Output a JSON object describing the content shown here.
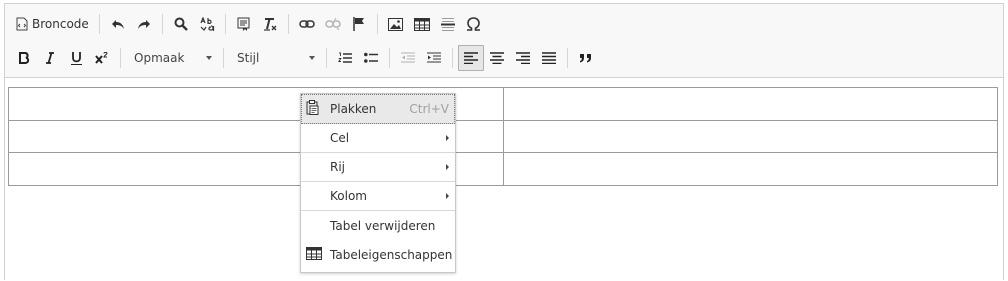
{
  "toolbar": {
    "source_label": "Broncode",
    "format_label": "Opmaak",
    "style_label": "Stijl"
  },
  "context_menu": {
    "items": [
      {
        "label": "Plakken",
        "shortcut": "Ctrl+V",
        "icon": "paste-icon"
      },
      {
        "label": "Cel",
        "icon": "submenu-arrow-icon"
      },
      {
        "label": "Rij",
        "icon": "submenu-arrow-icon"
      },
      {
        "label": "Kolom",
        "icon": "submenu-arrow-icon"
      },
      {
        "label": "Tabel verwijderen"
      },
      {
        "label": "Tabeleigenschappen",
        "icon": "table-icon"
      }
    ]
  },
  "table": {
    "rows": 3,
    "cols": 2
  }
}
